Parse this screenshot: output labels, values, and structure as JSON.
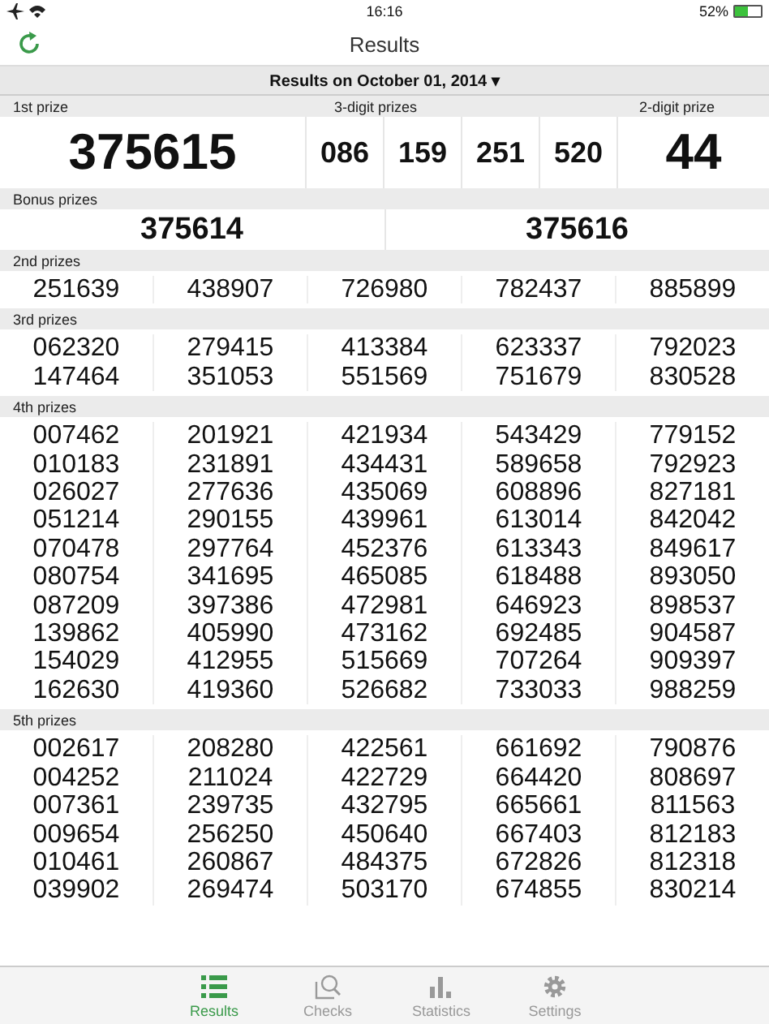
{
  "status_bar": {
    "time": "16:16",
    "battery": "52%"
  },
  "nav": {
    "title": "Results"
  },
  "date_bar": {
    "label": "Results on October 01, 2014",
    "caret": "▾"
  },
  "top": {
    "first_title": "1st prize",
    "first": "375615",
    "three_title": "3-digit prizes",
    "three": [
      "086",
      "159",
      "251",
      "520"
    ],
    "two_title": "2-digit prize",
    "two": "44"
  },
  "bonus": {
    "title": "Bonus prizes",
    "numbers": [
      "375614",
      "375616"
    ]
  },
  "sections": [
    {
      "title": "2nd prizes",
      "columns": [
        [
          "251639"
        ],
        [
          "438907"
        ],
        [
          "726980"
        ],
        [
          "782437"
        ],
        [
          "885899"
        ]
      ]
    },
    {
      "title": "3rd prizes",
      "columns": [
        [
          "062320",
          "147464"
        ],
        [
          "279415",
          "351053"
        ],
        [
          "413384",
          "551569"
        ],
        [
          "623337",
          "751679"
        ],
        [
          "792023",
          "830528"
        ]
      ]
    },
    {
      "title": "4th prizes",
      "columns": [
        [
          "007462",
          "010183",
          "026027",
          "051214",
          "070478",
          "080754",
          "087209",
          "139862",
          "154029",
          "162630"
        ],
        [
          "201921",
          "231891",
          "277636",
          "290155",
          "297764",
          "341695",
          "397386",
          "405990",
          "412955",
          "419360"
        ],
        [
          "421934",
          "434431",
          "435069",
          "439961",
          "452376",
          "465085",
          "472981",
          "473162",
          "515669",
          "526682"
        ],
        [
          "543429",
          "589658",
          "608896",
          "613014",
          "613343",
          "618488",
          "646923",
          "692485",
          "707264",
          "733033"
        ],
        [
          "779152",
          "792923",
          "827181",
          "842042",
          "849617",
          "893050",
          "898537",
          "904587",
          "909397",
          "988259"
        ]
      ]
    },
    {
      "title": "5th prizes",
      "columns": [
        [
          "002617",
          "004252",
          "007361",
          "009654",
          "010461",
          "039902"
        ],
        [
          "208280",
          "211024",
          "239735",
          "256250",
          "260867",
          "269474"
        ],
        [
          "422561",
          "422729",
          "432795",
          "450640",
          "484375",
          "503170"
        ],
        [
          "661692",
          "664420",
          "665661",
          "667403",
          "672826",
          "674855"
        ],
        [
          "790876",
          "808697",
          "811563",
          "812183",
          "812318",
          "830214"
        ]
      ]
    }
  ],
  "tabs": [
    {
      "label": "Results",
      "selected": true
    },
    {
      "label": "Checks",
      "selected": false
    },
    {
      "label": "Statistics",
      "selected": false
    },
    {
      "label": "Settings",
      "selected": false
    }
  ]
}
